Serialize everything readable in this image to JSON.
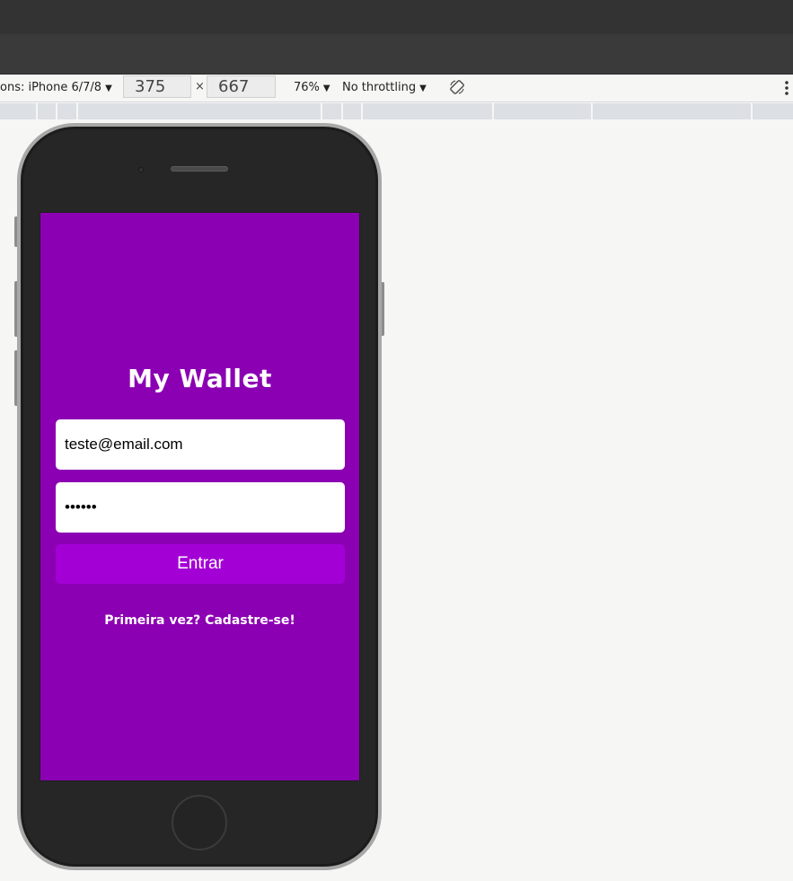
{
  "devtools": {
    "device_label": "ons: iPhone 6/7/8",
    "width_value": "375",
    "times_symbol": "×",
    "height_value": "667",
    "zoom": "76%",
    "throttling": "No throttling",
    "caret": "▼",
    "rotate_icon": "rotate-icon",
    "more_icon": "kebab-menu-icon"
  },
  "app": {
    "title": "My Wallet",
    "email_value": "teste@email.com",
    "password_value": "••••••",
    "enter_button": "Entrar",
    "signup_link": "Primeira vez? Cadastre-se!",
    "colors": {
      "background": "#8c00b3",
      "button": "#a300d6",
      "text": "#ffffff"
    }
  }
}
